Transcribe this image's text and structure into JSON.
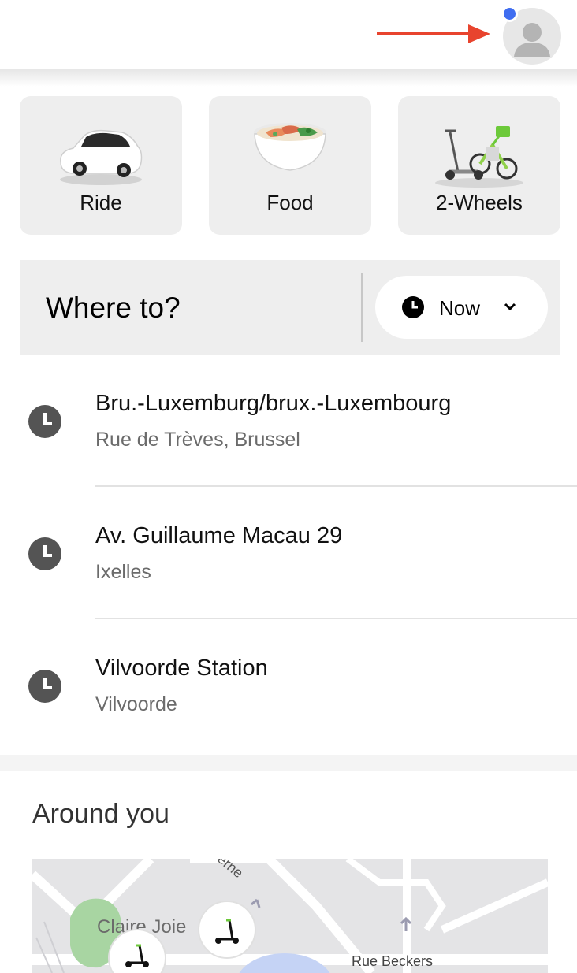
{
  "header": {
    "avatar_icon": "user-avatar-icon",
    "notification_color": "#3f6df0",
    "arrow_color": "#e8442e"
  },
  "services": [
    {
      "label": "Ride",
      "icon": "car-icon"
    },
    {
      "label": "Food",
      "icon": "food-bowl-icon"
    },
    {
      "label": "2-Wheels",
      "icon": "scooter-bike-icon"
    }
  ],
  "search": {
    "placeholder": "Where to?",
    "time_label": "Now",
    "time_icon": "clock-icon",
    "dropdown_icon": "chevron-down-icon"
  },
  "recent_places": [
    {
      "title": "Bru.-Luxemburg/brux.-Luxembourg",
      "subtitle": "Rue de Trèves, Brussel"
    },
    {
      "title": "Av. Guillaume Macau 29",
      "subtitle": "Ixelles"
    },
    {
      "title": "Vilvoorde Station",
      "subtitle": "Vilvoorde"
    }
  ],
  "around": {
    "heading": "Around you",
    "map_labels": {
      "park": "Claire Joie",
      "street_top": "erne",
      "street_bottom": "Rue Beckers"
    },
    "park_color": "#a8d5a2"
  }
}
